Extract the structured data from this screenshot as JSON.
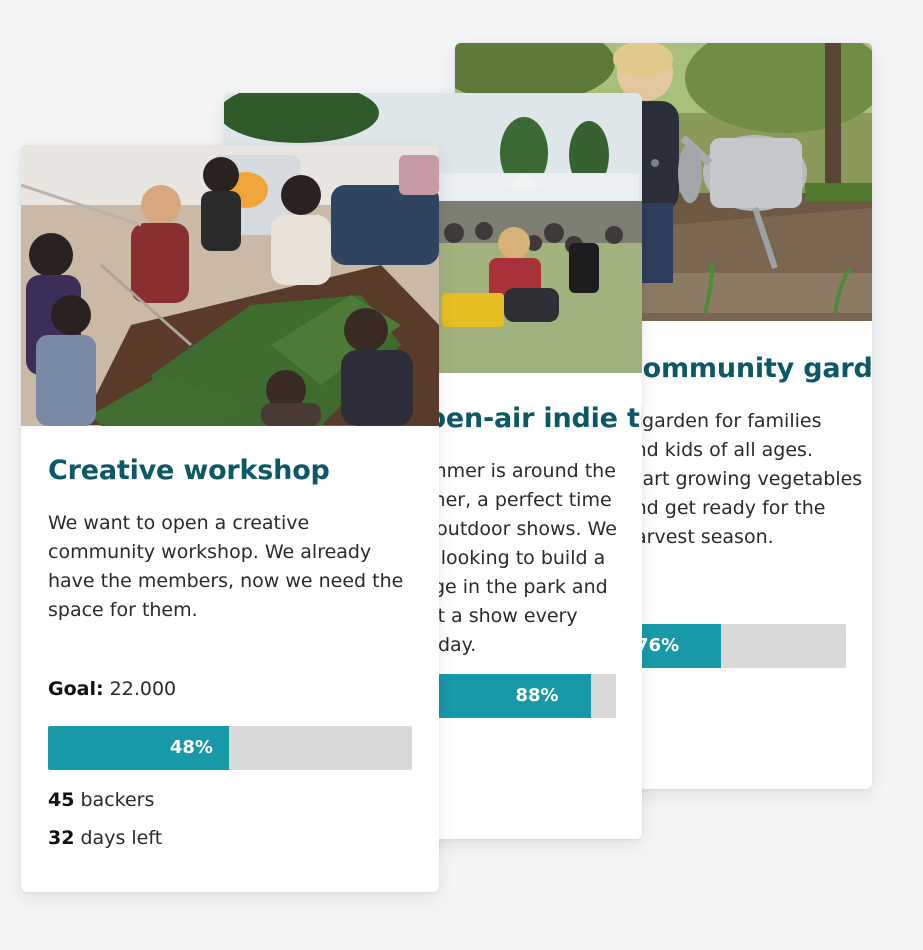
{
  "cards": [
    {
      "title": "Creative workshop",
      "description": "We want to open a creative community workshop. We already have the members, now we need the space for them.",
      "goal_label": "Goal:",
      "goal_value": "22.000",
      "progress": 48,
      "progress_label": "48%",
      "backers_count": "45",
      "backers_label": "backers",
      "days_count": "32",
      "days_label": "days left",
      "image": "people-crafting-at-table"
    },
    {
      "title": "Open-air indie theater",
      "description": "Summer is around the corner, a perfect time for outdoor shows. We are looking to build a stage in the park and host a show every sunday.",
      "progress": 88,
      "progress_label": "88%",
      "image": "festival-crowd-on-grass"
    },
    {
      "title": "Community garden",
      "description": "A garden for families and kids of all ages. Start growing vegetables and get ready for the harvest season.",
      "progress": 76,
      "progress_label": "76%",
      "image": "child-watering-garden-bed"
    }
  ],
  "colors": {
    "title": "#0c5866",
    "progress_fill": "#1899a8",
    "progress_track": "#d9d9d9",
    "background": "#f3f4f6"
  }
}
